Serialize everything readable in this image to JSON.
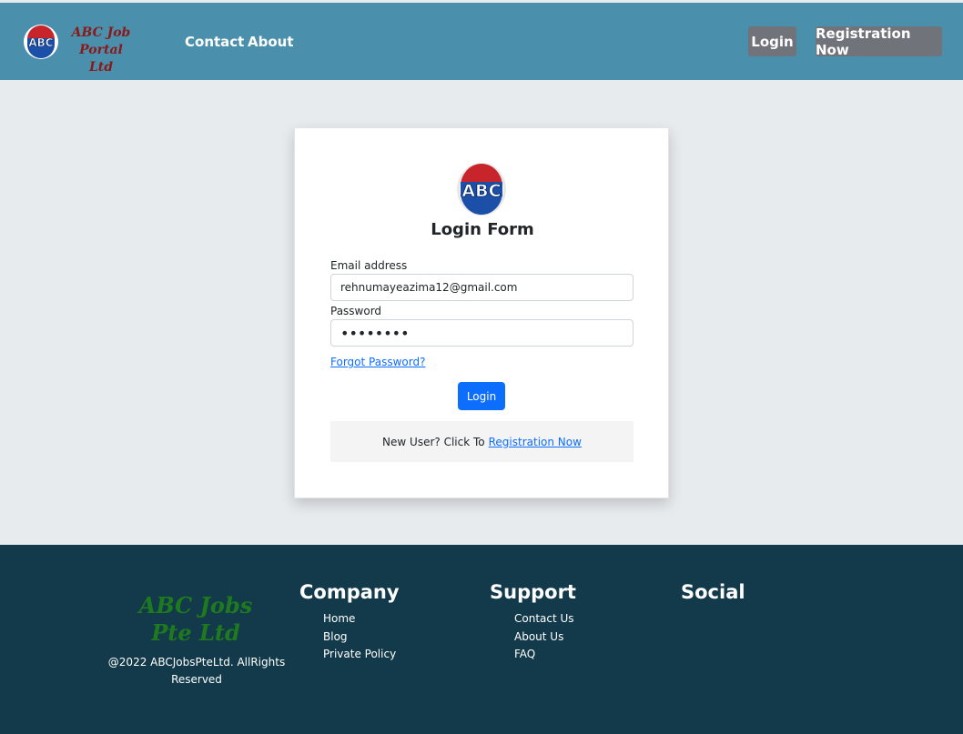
{
  "header": {
    "logo_icon": "abc-logo-icon",
    "brand_line1": "ABC Job",
    "brand_line2": "Portal Ltd",
    "nav_links": [
      "Contact",
      "About"
    ],
    "login_button": "Login",
    "register_button": "Registration Now"
  },
  "login_form": {
    "logo_icon": "abc-logo-icon",
    "title": "Login Form",
    "email_label": "Email address",
    "email_value": "rehnumayeazima12@gmail.com",
    "password_label": "Password",
    "password_value": "••••••••",
    "forgot_link": "Forgot Password?",
    "submit_label": "Login",
    "new_user_text": "New User? Click To",
    "new_user_link": "Registration Now"
  },
  "footer": {
    "brand_line1": "ABC Jobs",
    "brand_line2": "Pte Ltd",
    "copyright": "@2022 ABCJobsPteLtd. AllRights Reserved",
    "company": {
      "heading": "Company",
      "links": [
        "Home",
        "Blog",
        "Private Policy"
      ]
    },
    "support": {
      "heading": "Support",
      "links": [
        "Contact Us",
        "About Us",
        "FAQ"
      ]
    },
    "social": {
      "heading": "Social"
    }
  },
  "colors": {
    "navbar": "#4a8fac",
    "nav_button": "#707379",
    "primary": "#0d6efd",
    "footer": "#123a4a",
    "brand_red": "#8a1a1a",
    "brand_green": "#1f7a1f",
    "page_bg": "#e8ebee"
  }
}
